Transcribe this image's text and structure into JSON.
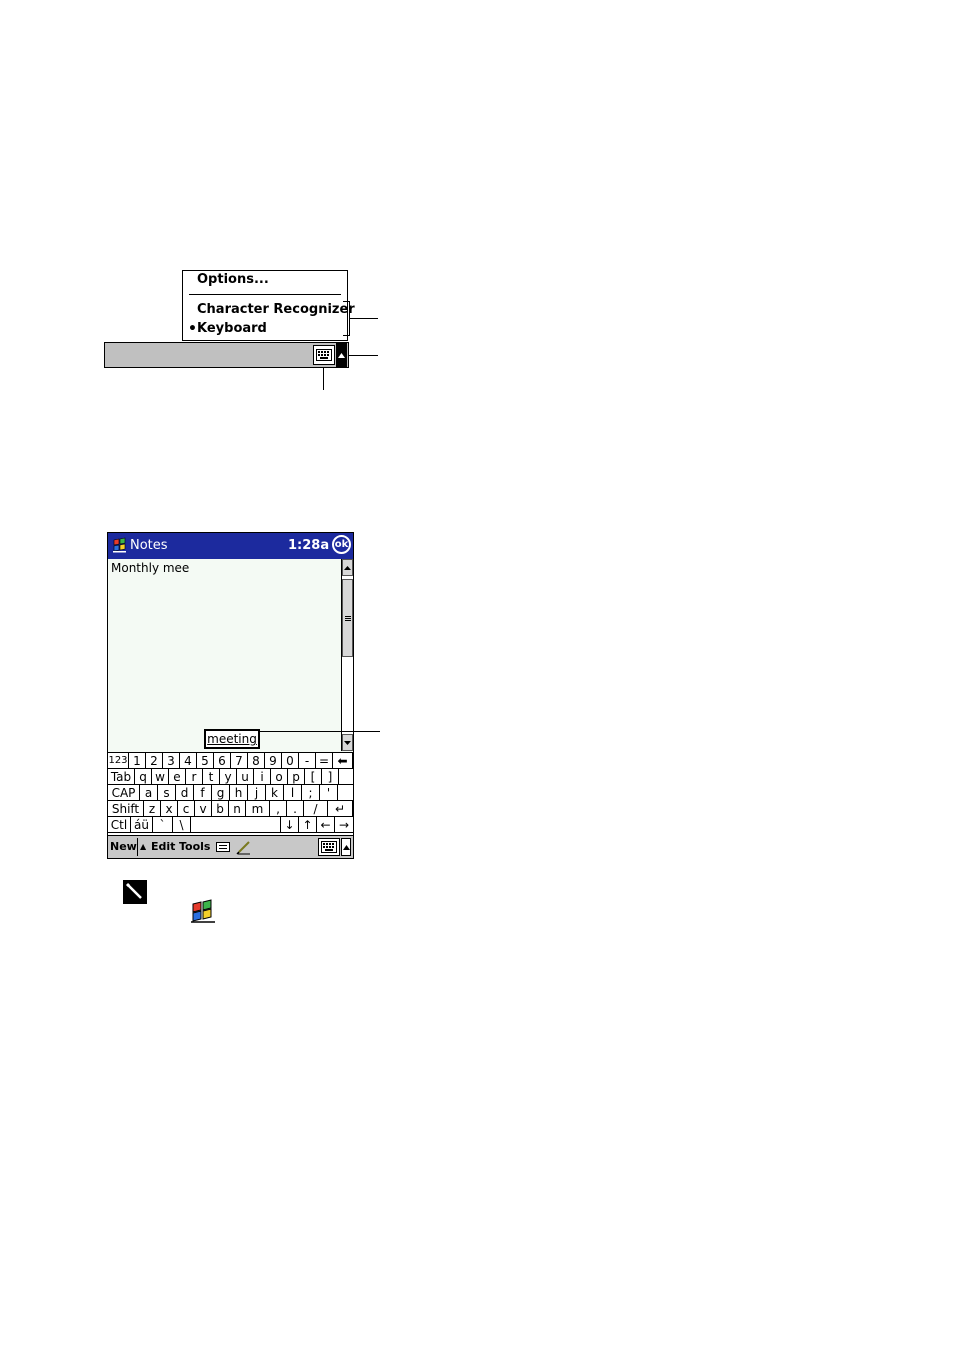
{
  "input_menu": {
    "options_label": "Options...",
    "items": [
      {
        "label": "Character Recognizer",
        "selected": false
      },
      {
        "label": "Keyboard",
        "selected": true
      }
    ],
    "bullet": "•"
  },
  "notes_screen": {
    "title": "Notes",
    "time": "1:28a",
    "ok_label": "ok",
    "note_text": "Monthly mee",
    "suggestion": "meeting",
    "keyboard": {
      "row1": [
        "123",
        "1",
        "2",
        "3",
        "4",
        "5",
        "6",
        "7",
        "8",
        "9",
        "0",
        "-",
        "=",
        "⬅"
      ],
      "row2": [
        "Tab",
        "q",
        "w",
        "e",
        "r",
        "t",
        "y",
        "u",
        "i",
        "o",
        "p",
        "[",
        "]"
      ],
      "row3": [
        "CAP",
        "a",
        "s",
        "d",
        "f",
        "g",
        "h",
        "j",
        "k",
        "l",
        ";",
        "'"
      ],
      "row4": [
        "Shift",
        "z",
        "x",
        "c",
        "v",
        "b",
        "n",
        "m",
        ",",
        ".",
        "/",
        "↵"
      ],
      "row5": [
        "Ctl",
        "áü",
        "`",
        "\\",
        "",
        "↓",
        "↑",
        "←",
        "→"
      ]
    },
    "menu_bar": {
      "new_label": "New",
      "edit_label": "Edit",
      "tools_label": "Tools",
      "up_arrow": "▲"
    }
  },
  "icons": {
    "input_panel": "keyboard-icon",
    "input_selector": "up-arrow-icon",
    "start": "windows-flag-icon",
    "pen": "pen-icon"
  }
}
